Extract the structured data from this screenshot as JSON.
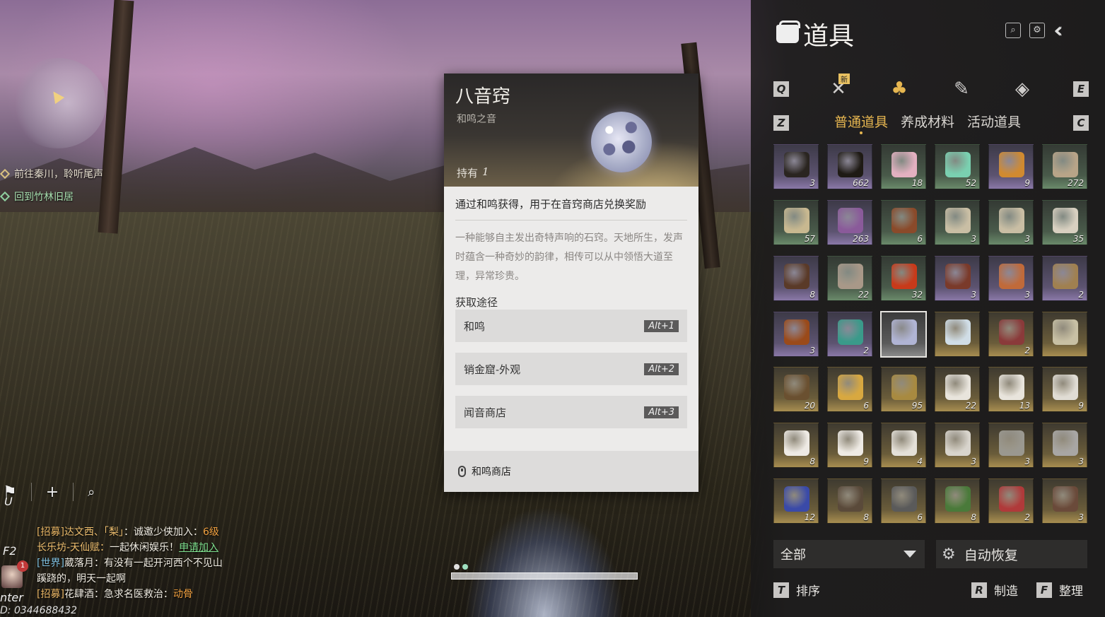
{
  "hud": {
    "quests": [
      {
        "label": "前往秦川，聆听尾声"
      },
      {
        "label": "回到竹林旧居"
      }
    ],
    "tools": {
      "add": "+",
      "search": "⌕"
    },
    "keys": {
      "u": "U",
      "f2": "F2",
      "enter": "nter"
    },
    "avatar_badge": "1",
    "chat": [
      {
        "channel": "[招募]",
        "name": "达文西、「梨」",
        "msg": "：诚邀少侠加入：",
        "extra": "6级"
      },
      {
        "prefix": "长乐坊-天仙赋：",
        "msg": "一起休闲娱乐！",
        "link": "申请加入"
      },
      {
        "channel": "[世界]",
        "name": "葳落月",
        "msg": "：有没有一起开河西个不见山",
        "msg2": "蹊跷的，明天一起啊"
      },
      {
        "channel": "[招募]",
        "name": "花肆酒",
        "msg": "：急求名医救治：",
        "extra": "动骨"
      }
    ],
    "uid": "D: 0344688432"
  },
  "tooltip": {
    "title": "八音窍",
    "subtitle": "和鸣之音",
    "own_label": "持有",
    "own_count": "1",
    "description": "通过和鸣获得，用于在音窍商店兑换奖励",
    "lore": "一种能够自主发出奇特声响的石窍。天地所生，发声时蕴含一种奇妙的韵律，相传可以从中领悟大道至理，异常珍贵。",
    "sources_title": "获取途径",
    "sources": [
      {
        "label": "和鸣",
        "key": "Alt+1"
      },
      {
        "label": "销金窟-外观",
        "key": "Alt+2"
      },
      {
        "label": "闻音商店",
        "key": "Alt+3"
      }
    ],
    "footer_action": "和鸣商店"
  },
  "inventory": {
    "title": "道具",
    "new_badge": "新",
    "keys": {
      "q": "Q",
      "e": "E",
      "z": "Z",
      "c": "C"
    },
    "categories": [
      "equipment-icon",
      "item-bag-icon",
      "scroll-icon",
      "token-icon"
    ],
    "subtabs": [
      "普通道具",
      "养成材料",
      "活动道具"
    ],
    "active_subtab": 0,
    "accent_color": "#e6b650",
    "items": [
      {
        "qty": "3",
        "rarity": "r-purple",
        "color": "#2a2520"
      },
      {
        "qty": "662",
        "rarity": "r-purple",
        "color": "#1e1a14"
      },
      {
        "qty": "18",
        "rarity": "r-green",
        "color": "#e3b0c0"
      },
      {
        "qty": "52",
        "rarity": "r-green",
        "color": "#7ad0b0"
      },
      {
        "qty": "9",
        "rarity": "r-purple",
        "color": "#d08a30"
      },
      {
        "qty": "272",
        "rarity": "r-green",
        "color": "#b8a488"
      },
      {
        "qty": "57",
        "rarity": "r-green",
        "color": "#c8b890"
      },
      {
        "qty": "263",
        "rarity": "r-purple",
        "color": "#8a5a9a"
      },
      {
        "qty": "6",
        "rarity": "r-green",
        "color": "#8a4a2a"
      },
      {
        "qty": "3",
        "rarity": "r-green",
        "color": "#c9bea4"
      },
      {
        "qty": "3",
        "rarity": "r-green",
        "color": "#c9bea4"
      },
      {
        "qty": "35",
        "rarity": "r-green",
        "color": "#d8d0c0"
      },
      {
        "qty": "8",
        "rarity": "r-purple",
        "color": "#5a3a28"
      },
      {
        "qty": "22",
        "rarity": "r-green",
        "color": "#a89888"
      },
      {
        "qty": "32",
        "rarity": "r-green",
        "color": "#c83a1a"
      },
      {
        "qty": "3",
        "rarity": "r-purple",
        "color": "#7a3a2a"
      },
      {
        "qty": "3",
        "rarity": "r-purple",
        "color": "#c06a3a"
      },
      {
        "qty": "2",
        "rarity": "r-purple",
        "color": "#a08050"
      },
      {
        "qty": "3",
        "rarity": "r-purple",
        "color": "#9a4a1a"
      },
      {
        "qty": "2",
        "rarity": "r-purple",
        "color": "#3a9a8a"
      },
      {
        "qty": "",
        "rarity": "r-white",
        "color": "#b0b4d4"
      },
      {
        "qty": "",
        "rarity": "r-gold",
        "color": "#d0dde6"
      },
      {
        "qty": "2",
        "rarity": "r-gold",
        "color": "#8a3a3a"
      },
      {
        "qty": "",
        "rarity": "r-gold",
        "color": "#c8c0a4"
      },
      {
        "qty": "20",
        "rarity": "r-gold",
        "color": "#6a5030"
      },
      {
        "qty": "6",
        "rarity": "r-gold",
        "color": "#d8a840"
      },
      {
        "qty": "95",
        "rarity": "r-gold",
        "color": "#a88a40"
      },
      {
        "qty": "22",
        "rarity": "r-gold",
        "color": "#e8e4dc"
      },
      {
        "qty": "13",
        "rarity": "r-gold",
        "color": "#e8e4dc"
      },
      {
        "qty": "9",
        "rarity": "r-gold",
        "color": "#e0dcd4"
      },
      {
        "qty": "8",
        "rarity": "r-gold",
        "color": "#eeeae4"
      },
      {
        "qty": "9",
        "rarity": "r-gold",
        "color": "#eeeae4"
      },
      {
        "qty": "4",
        "rarity": "r-gold",
        "color": "#e4e0d8"
      },
      {
        "qty": "3",
        "rarity": "r-gold",
        "color": "#d8d4cc"
      },
      {
        "qty": "3",
        "rarity": "r-gold",
        "color": "#9a9890"
      },
      {
        "qty": "3",
        "rarity": "r-gold",
        "color": "#a8a6a4"
      },
      {
        "qty": "12",
        "rarity": "r-gold",
        "color": "#3a4aa8"
      },
      {
        "qty": "8",
        "rarity": "r-gold",
        "color": "#5a4a3a"
      },
      {
        "qty": "6",
        "rarity": "r-gold",
        "color": "#5a5a5a"
      },
      {
        "qty": "8",
        "rarity": "r-gold",
        "color": "#4a7a3a"
      },
      {
        "qty": "2",
        "rarity": "r-gold",
        "color": "#b03a3a"
      },
      {
        "qty": "3",
        "rarity": "r-gold",
        "color": "#6a4a3a"
      }
    ],
    "selected_index": 20,
    "filter_label": "全部",
    "auto_restore_label": "自动恢复",
    "actions": [
      {
        "key": "T",
        "label": "排序"
      },
      {
        "key": "R",
        "label": "制造"
      },
      {
        "key": "F",
        "label": "整理"
      }
    ]
  }
}
